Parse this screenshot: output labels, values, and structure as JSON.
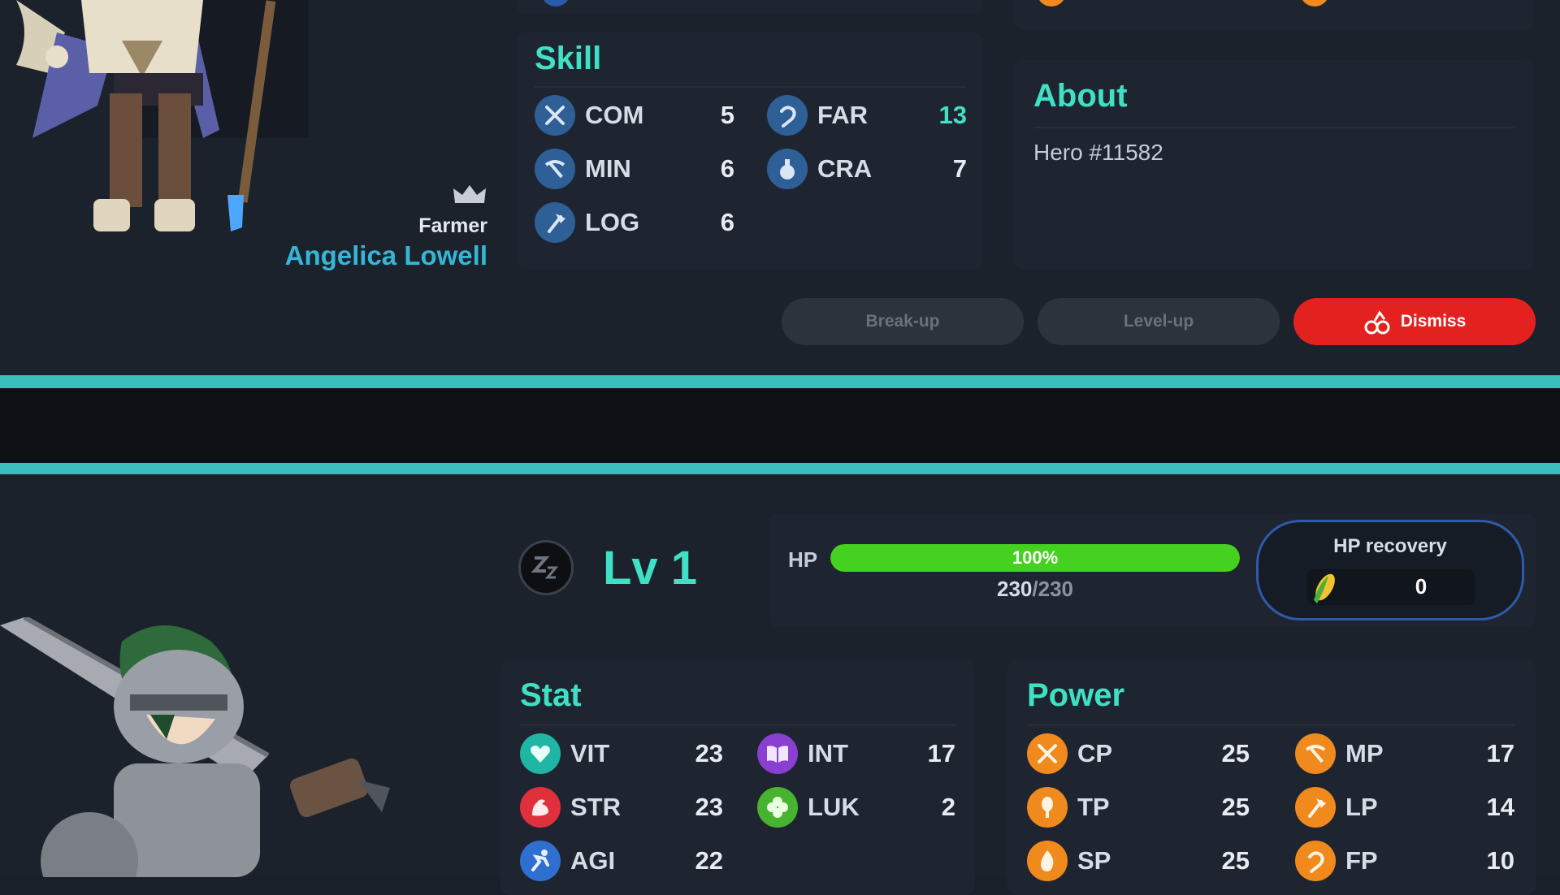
{
  "hero1": {
    "class_label": "Farmer",
    "name": "Angelica Lowell",
    "skill": {
      "title": "Skill",
      "items": [
        {
          "label": "COM",
          "value": "5",
          "icon": "crossed-swords-icon"
        },
        {
          "label": "FAR",
          "value": "13",
          "icon": "sickle-icon",
          "highlight": "#3fe0c4"
        },
        {
          "label": "MIN",
          "value": "6",
          "icon": "pickaxe-icon"
        },
        {
          "label": "CRA",
          "value": "7",
          "icon": "potion-icon"
        },
        {
          "label": "LOG",
          "value": "6",
          "icon": "axe-icon"
        }
      ]
    },
    "about": {
      "title": "About",
      "text": "Hero #11582"
    },
    "buttons": {
      "breakup": "Break-up",
      "levelup": "Level-up",
      "dismiss": "Dismiss"
    }
  },
  "hero2": {
    "level": "Lv 1",
    "hp": {
      "label": "HP",
      "percent_text": "100%",
      "fill": 1.0,
      "current": "230",
      "max": "230"
    },
    "hp_recovery": {
      "title": "HP recovery",
      "value": "0"
    },
    "stat": {
      "title": "Stat",
      "items": [
        {
          "label": "VIT",
          "value": "23",
          "icon": "heart-icon",
          "color": "#1fb7a3"
        },
        {
          "label": "INT",
          "value": "17",
          "icon": "book-icon",
          "color": "#8a3fd1"
        },
        {
          "label": "STR",
          "value": "23",
          "icon": "muscle-icon",
          "color": "#e0303b"
        },
        {
          "label": "LUK",
          "value": "2",
          "icon": "clover-icon",
          "color": "#47b32e"
        },
        {
          "label": "AGI",
          "value": "22",
          "icon": "running-icon",
          "color": "#2f6fd0"
        }
      ]
    },
    "power": {
      "title": "Power",
      "items": [
        {
          "label": "CP",
          "value": "25",
          "icon": "crossed-swords-icon"
        },
        {
          "label": "MP",
          "value": "17",
          "icon": "pickaxe-icon"
        },
        {
          "label": "TP",
          "value": "25",
          "icon": "wheat-icon"
        },
        {
          "label": "LP",
          "value": "14",
          "icon": "axe-icon"
        },
        {
          "label": "SP",
          "value": "25",
          "icon": "flame-icon"
        },
        {
          "label": "FP",
          "value": "10",
          "icon": "sickle-icon"
        }
      ]
    }
  },
  "colors": {
    "accent": "#3fe0c4",
    "name": "#36b6d6",
    "dismiss": "#e3221f",
    "hp_bar": "#45d11f",
    "power_icon": "#f08a1c",
    "skill_icon": "#2e5f96"
  }
}
